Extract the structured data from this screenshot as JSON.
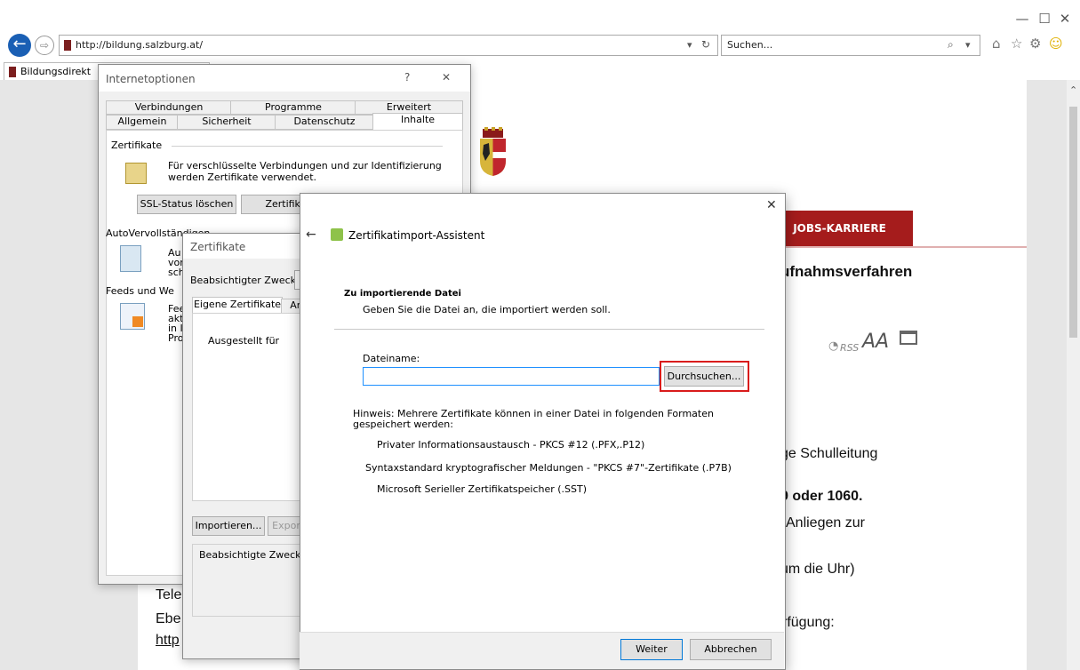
{
  "browser": {
    "url": "http://bildung.salzburg.at/",
    "search_placeholder": "Suchen...",
    "tab_title": "Bildungsdirekt"
  },
  "page": {
    "jobs_tab": "JOBS-KARRIERE",
    "heading_fragment": "ufnahmsverfahren",
    "rss_label": "RSS",
    "font_icon": "AA",
    "line1_fragment": "ge Schulleitung",
    "line2_fragment": "9 oder 1060.",
    "line3_fragment": "Anliegen zur",
    "line4_fragment": "um die Uhr)",
    "line5_fragment": "rfügung:",
    "tele_fragment": "Tele",
    "ebe_fragment": "Ebe",
    "http_fragment": "http"
  },
  "internetoptionen": {
    "title": "Internetoptionen",
    "help": "?",
    "close": "✕",
    "tabs_row1": [
      "Verbindungen",
      "Programme",
      "Erweitert"
    ],
    "tabs_row2": [
      "Allgemein",
      "Sicherheit",
      "Datenschutz",
      "Inhalte"
    ],
    "group_cert": "Zertifikate",
    "cert_desc": "Für verschlüsselte Verbindungen und zur Identifizierung werden Zertifikate verwendet.",
    "ssl_button": "SSL-Status löschen",
    "cert_button": "Zertifikate",
    "group_autocomplete": "AutoVervollständigen",
    "autocomplete_text": [
      "Au",
      "vor",
      "sch"
    ],
    "group_feeds": "Feeds und We",
    "feeds_text": [
      "Fee",
      "akt",
      "in I",
      "Pro"
    ]
  },
  "zertifikate": {
    "title": "Zertifikate",
    "purpose_label": "Beabsichtigter Zweck:",
    "tabs": [
      "Eigene Zertifikate",
      "And"
    ],
    "column_header": "Ausgestellt für",
    "import_button": "Importieren...",
    "export_button": "Expor",
    "purposes_label": "Beabsichtigte Zwecke d"
  },
  "wizard": {
    "back": "←",
    "title": "Zertifikatimport-Assistent",
    "close": "✕",
    "section_title": "Zu importierende Datei",
    "section_desc": "Geben Sie die Datei an, die importiert werden soll.",
    "filename_label": "Dateiname:",
    "filename_value": "",
    "browse_button": "Durchsuchen...",
    "hint": "Hinweis: Mehrere Zertifikate können in einer Datei in folgenden Formaten gespeichert werden:",
    "formats": [
      "Privater Informationsaustausch - PKCS #12 (.PFX,.P12)",
      "Syntaxstandard kryptografischer Meldungen - \"PKCS #7\"-Zertifikate (.P7B)",
      "Microsoft Serieller Zertifikatspeicher (.SST)"
    ],
    "next_button": "Weiter",
    "cancel_button": "Abbrechen"
  },
  "colors": {
    "brand_red": "#a51c1c",
    "highlight_red": "#d91c1c",
    "ie_blue": "#1a5fb4"
  }
}
